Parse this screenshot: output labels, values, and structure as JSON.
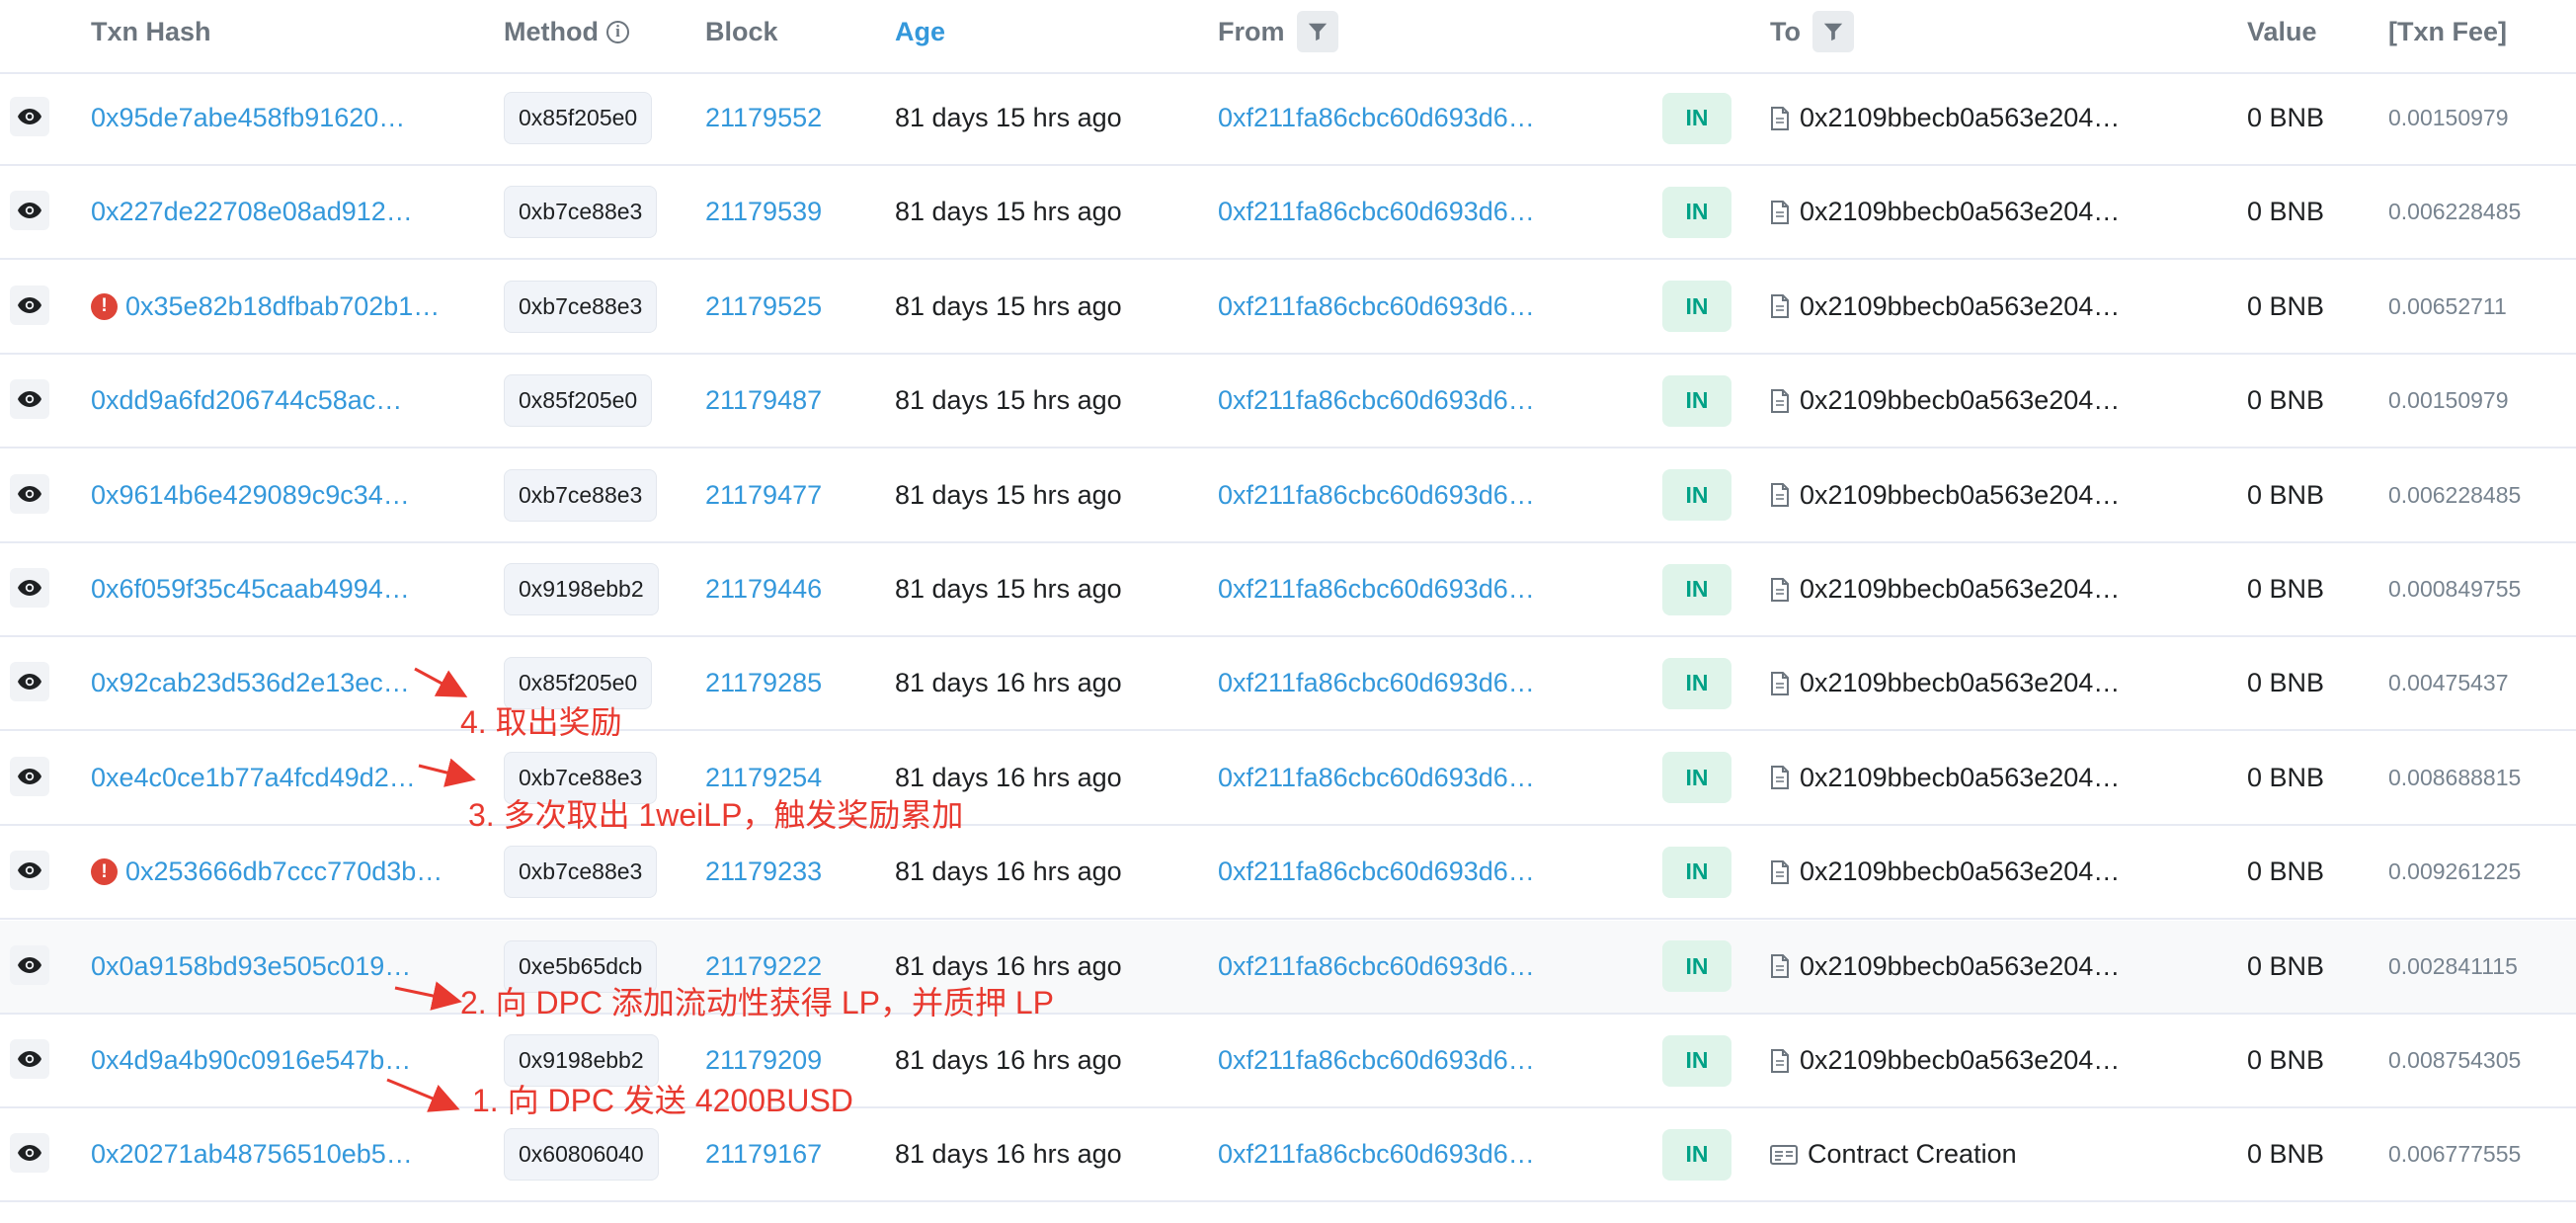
{
  "header": {
    "txn_hash": "Txn Hash",
    "method": "Method",
    "block": "Block",
    "age": "Age",
    "from": "From",
    "to": "To",
    "value": "Value",
    "txn_fee": "[Txn Fee]"
  },
  "rows": [
    {
      "hash": "0x95de7abe458fb91620…",
      "error": false,
      "method": "0x85f205e0",
      "block": "21179552",
      "age": "81 days 15 hrs ago",
      "from": "0xf211fa86cbc60d693d6…",
      "direction": "IN",
      "to": "0x2109bbecb0a563e204…",
      "to_icon": "document-icon",
      "value": "0 BNB",
      "fee": "0.00150979"
    },
    {
      "hash": "0x227de22708e08ad912…",
      "error": false,
      "method": "0xb7ce88e3",
      "block": "21179539",
      "age": "81 days 15 hrs ago",
      "from": "0xf211fa86cbc60d693d6…",
      "direction": "IN",
      "to": "0x2109bbecb0a563e204…",
      "to_icon": "document-icon",
      "value": "0 BNB",
      "fee": "0.006228485"
    },
    {
      "hash": "0x35e82b18dfbab702b1…",
      "error": true,
      "method": "0xb7ce88e3",
      "block": "21179525",
      "age": "81 days 15 hrs ago",
      "from": "0xf211fa86cbc60d693d6…",
      "direction": "IN",
      "to": "0x2109bbecb0a563e204…",
      "to_icon": "document-icon",
      "value": "0 BNB",
      "fee": "0.00652711"
    },
    {
      "hash": "0xdd9a6fd206744c58ac…",
      "error": false,
      "method": "0x85f205e0",
      "block": "21179487",
      "age": "81 days 15 hrs ago",
      "from": "0xf211fa86cbc60d693d6…",
      "direction": "IN",
      "to": "0x2109bbecb0a563e204…",
      "to_icon": "document-icon",
      "value": "0 BNB",
      "fee": "0.00150979"
    },
    {
      "hash": "0x9614b6e429089c9c34…",
      "error": false,
      "method": "0xb7ce88e3",
      "block": "21179477",
      "age": "81 days 15 hrs ago",
      "from": "0xf211fa86cbc60d693d6…",
      "direction": "IN",
      "to": "0x2109bbecb0a563e204…",
      "to_icon": "document-icon",
      "value": "0 BNB",
      "fee": "0.006228485"
    },
    {
      "hash": "0x6f059f35c45caab4994…",
      "error": false,
      "method": "0x9198ebb2",
      "block": "21179446",
      "age": "81 days 15 hrs ago",
      "from": "0xf211fa86cbc60d693d6…",
      "direction": "IN",
      "to": "0x2109bbecb0a563e204…",
      "to_icon": "document-icon",
      "value": "0 BNB",
      "fee": "0.000849755"
    },
    {
      "hash": "0x92cab23d536d2e13ec…",
      "error": false,
      "method": "0x85f205e0",
      "block": "21179285",
      "age": "81 days 16 hrs ago",
      "from": "0xf211fa86cbc60d693d6…",
      "direction": "IN",
      "to": "0x2109bbecb0a563e204…",
      "to_icon": "document-icon",
      "value": "0 BNB",
      "fee": "0.00475437"
    },
    {
      "hash": "0xe4c0ce1b77a4fcd49d2…",
      "error": false,
      "method": "0xb7ce88e3",
      "block": "21179254",
      "age": "81 days 16 hrs ago",
      "from": "0xf211fa86cbc60d693d6…",
      "direction": "IN",
      "to": "0x2109bbecb0a563e204…",
      "to_icon": "document-icon",
      "value": "0 BNB",
      "fee": "0.008688815"
    },
    {
      "hash": "0x253666db7ccc770d3b…",
      "error": true,
      "method": "0xb7ce88e3",
      "block": "21179233",
      "age": "81 days 16 hrs ago",
      "from": "0xf211fa86cbc60d693d6…",
      "direction": "IN",
      "to": "0x2109bbecb0a563e204…",
      "to_icon": "document-icon",
      "value": "0 BNB",
      "fee": "0.009261225"
    },
    {
      "hash": "0x0a9158bd93e505c019…",
      "error": false,
      "method": "0xe5b65dcb",
      "block": "21179222",
      "age": "81 days 16 hrs ago",
      "from": "0xf211fa86cbc60d693d6…",
      "direction": "IN",
      "to": "0x2109bbecb0a563e204…",
      "to_icon": "document-icon",
      "value": "0 BNB",
      "fee": "0.002841115"
    },
    {
      "hash": "0x4d9a4b90c0916e547b…",
      "error": false,
      "method": "0x9198ebb2",
      "block": "21179209",
      "age": "81 days 16 hrs ago",
      "from": "0xf211fa86cbc60d693d6…",
      "direction": "IN",
      "to": "0x2109bbecb0a563e204…",
      "to_icon": "document-icon",
      "value": "0 BNB",
      "fee": "0.008754305"
    },
    {
      "hash": "0x20271ab48756510eb5…",
      "error": false,
      "method": "0x60806040",
      "block": "21179167",
      "age": "81 days 16 hrs ago",
      "from": "0xf211fa86cbc60d693d6…",
      "direction": "IN",
      "to": "Contract Creation",
      "to_icon": "contract-creation-icon",
      "value": "0 BNB",
      "fee": "0.006777555"
    }
  ],
  "annotations": [
    {
      "text": "4. 取出奖励"
    },
    {
      "text": "3. 多次取出 1weiLP，触发奖励累加"
    },
    {
      "text": "2. 向 DPC 添加流动性获得 LP，并质押 LP"
    },
    {
      "text": "1. 向 DPC 发送 4200BUSD"
    }
  ],
  "colors": {
    "link": "#3498db",
    "badge_bg": "#dff4ea",
    "badge_text": "#00a186",
    "error": "#de4437",
    "annotation": "#e8392f"
  }
}
